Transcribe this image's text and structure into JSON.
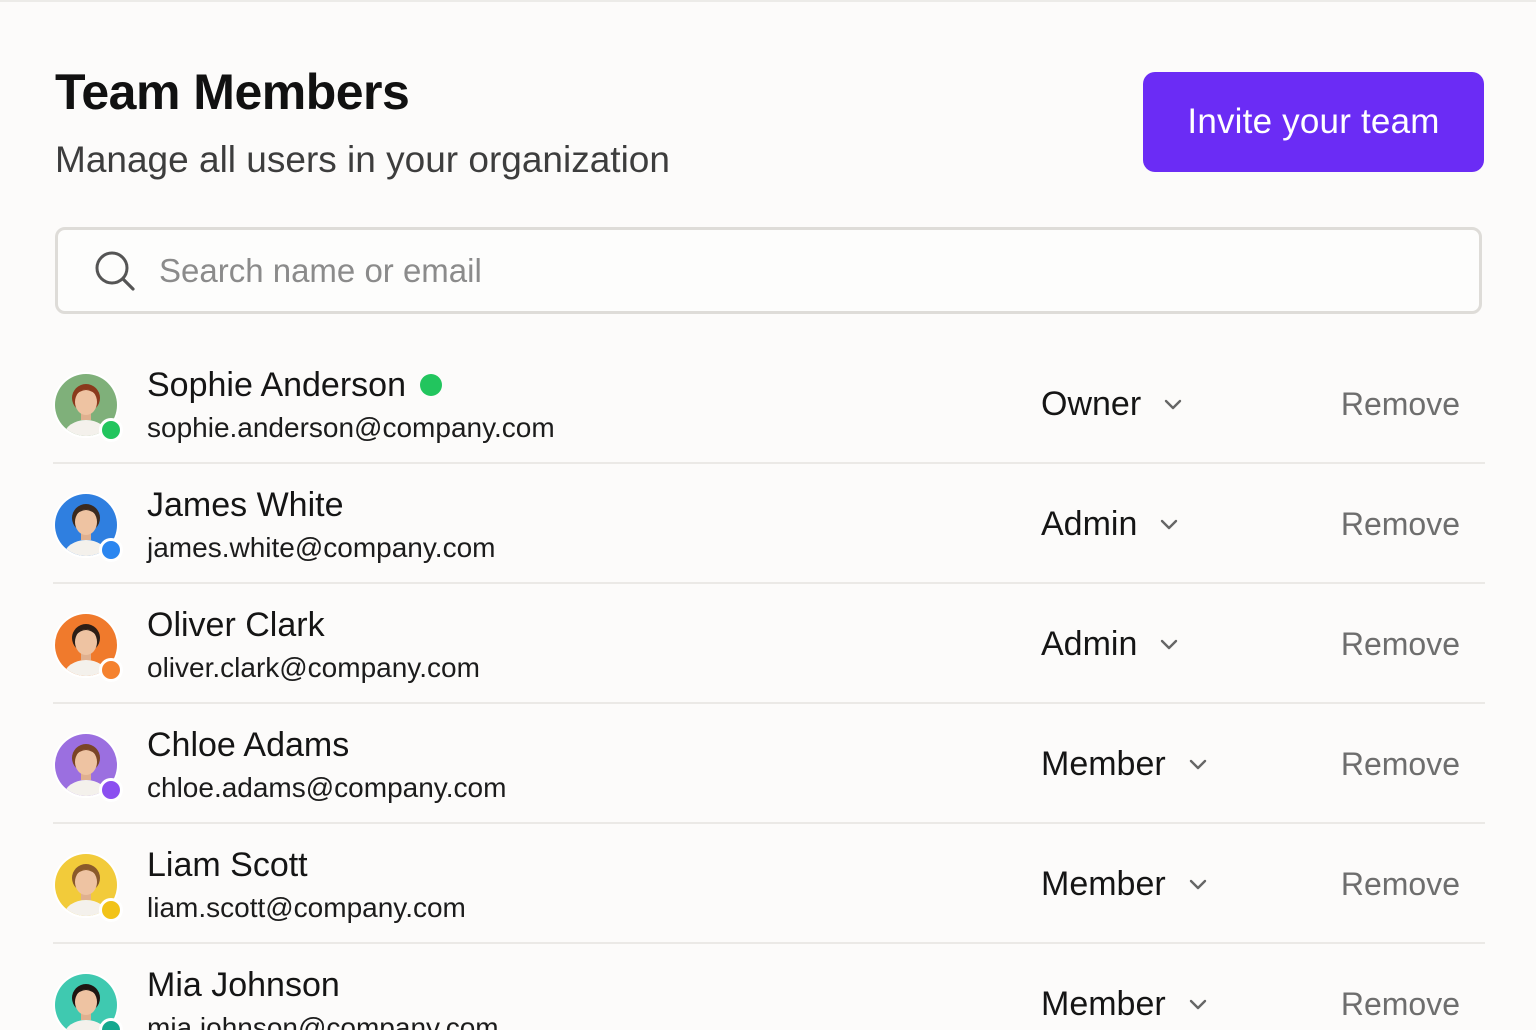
{
  "header": {
    "title": "Team Members",
    "subtitle": "Manage all users in your organization",
    "invite_label": "Invite your team"
  },
  "search": {
    "placeholder": "Search name or email",
    "value": ""
  },
  "colors": {
    "accent": "#6b2cf5",
    "online": "#22c55e"
  },
  "members": [
    {
      "name": "Sophie Anderson",
      "email": "sophie.anderson@company.com",
      "role": "Owner",
      "action": "Remove",
      "online": true,
      "avatar_bg": "#7fb07a",
      "status_color": "#22c55e"
    },
    {
      "name": "James White",
      "email": "james.white@company.com",
      "role": "Admin",
      "action": "Remove",
      "online": false,
      "avatar_bg": "#2f7fe0",
      "status_color": "#2b86f0"
    },
    {
      "name": "Oliver Clark",
      "email": "oliver.clark@company.com",
      "role": "Admin",
      "action": "Remove",
      "online": false,
      "avatar_bg": "#f07a2c",
      "status_color": "#f5822f"
    },
    {
      "name": "Chloe Adams",
      "email": "chloe.adams@company.com",
      "role": "Member",
      "action": "Remove",
      "online": false,
      "avatar_bg": "#9b6fe0",
      "status_color": "#8b4ff0"
    },
    {
      "name": "Liam Scott",
      "email": "liam.scott@company.com",
      "role": "Member",
      "action": "Remove",
      "online": false,
      "avatar_bg": "#f2cb3a",
      "status_color": "#f2c318"
    },
    {
      "name": "Mia Johnson",
      "email": "mia.johnson@company.com",
      "role": "Member",
      "action": "Remove",
      "online": false,
      "avatar_bg": "#3fc9b0",
      "status_color": "#14a88f"
    }
  ]
}
